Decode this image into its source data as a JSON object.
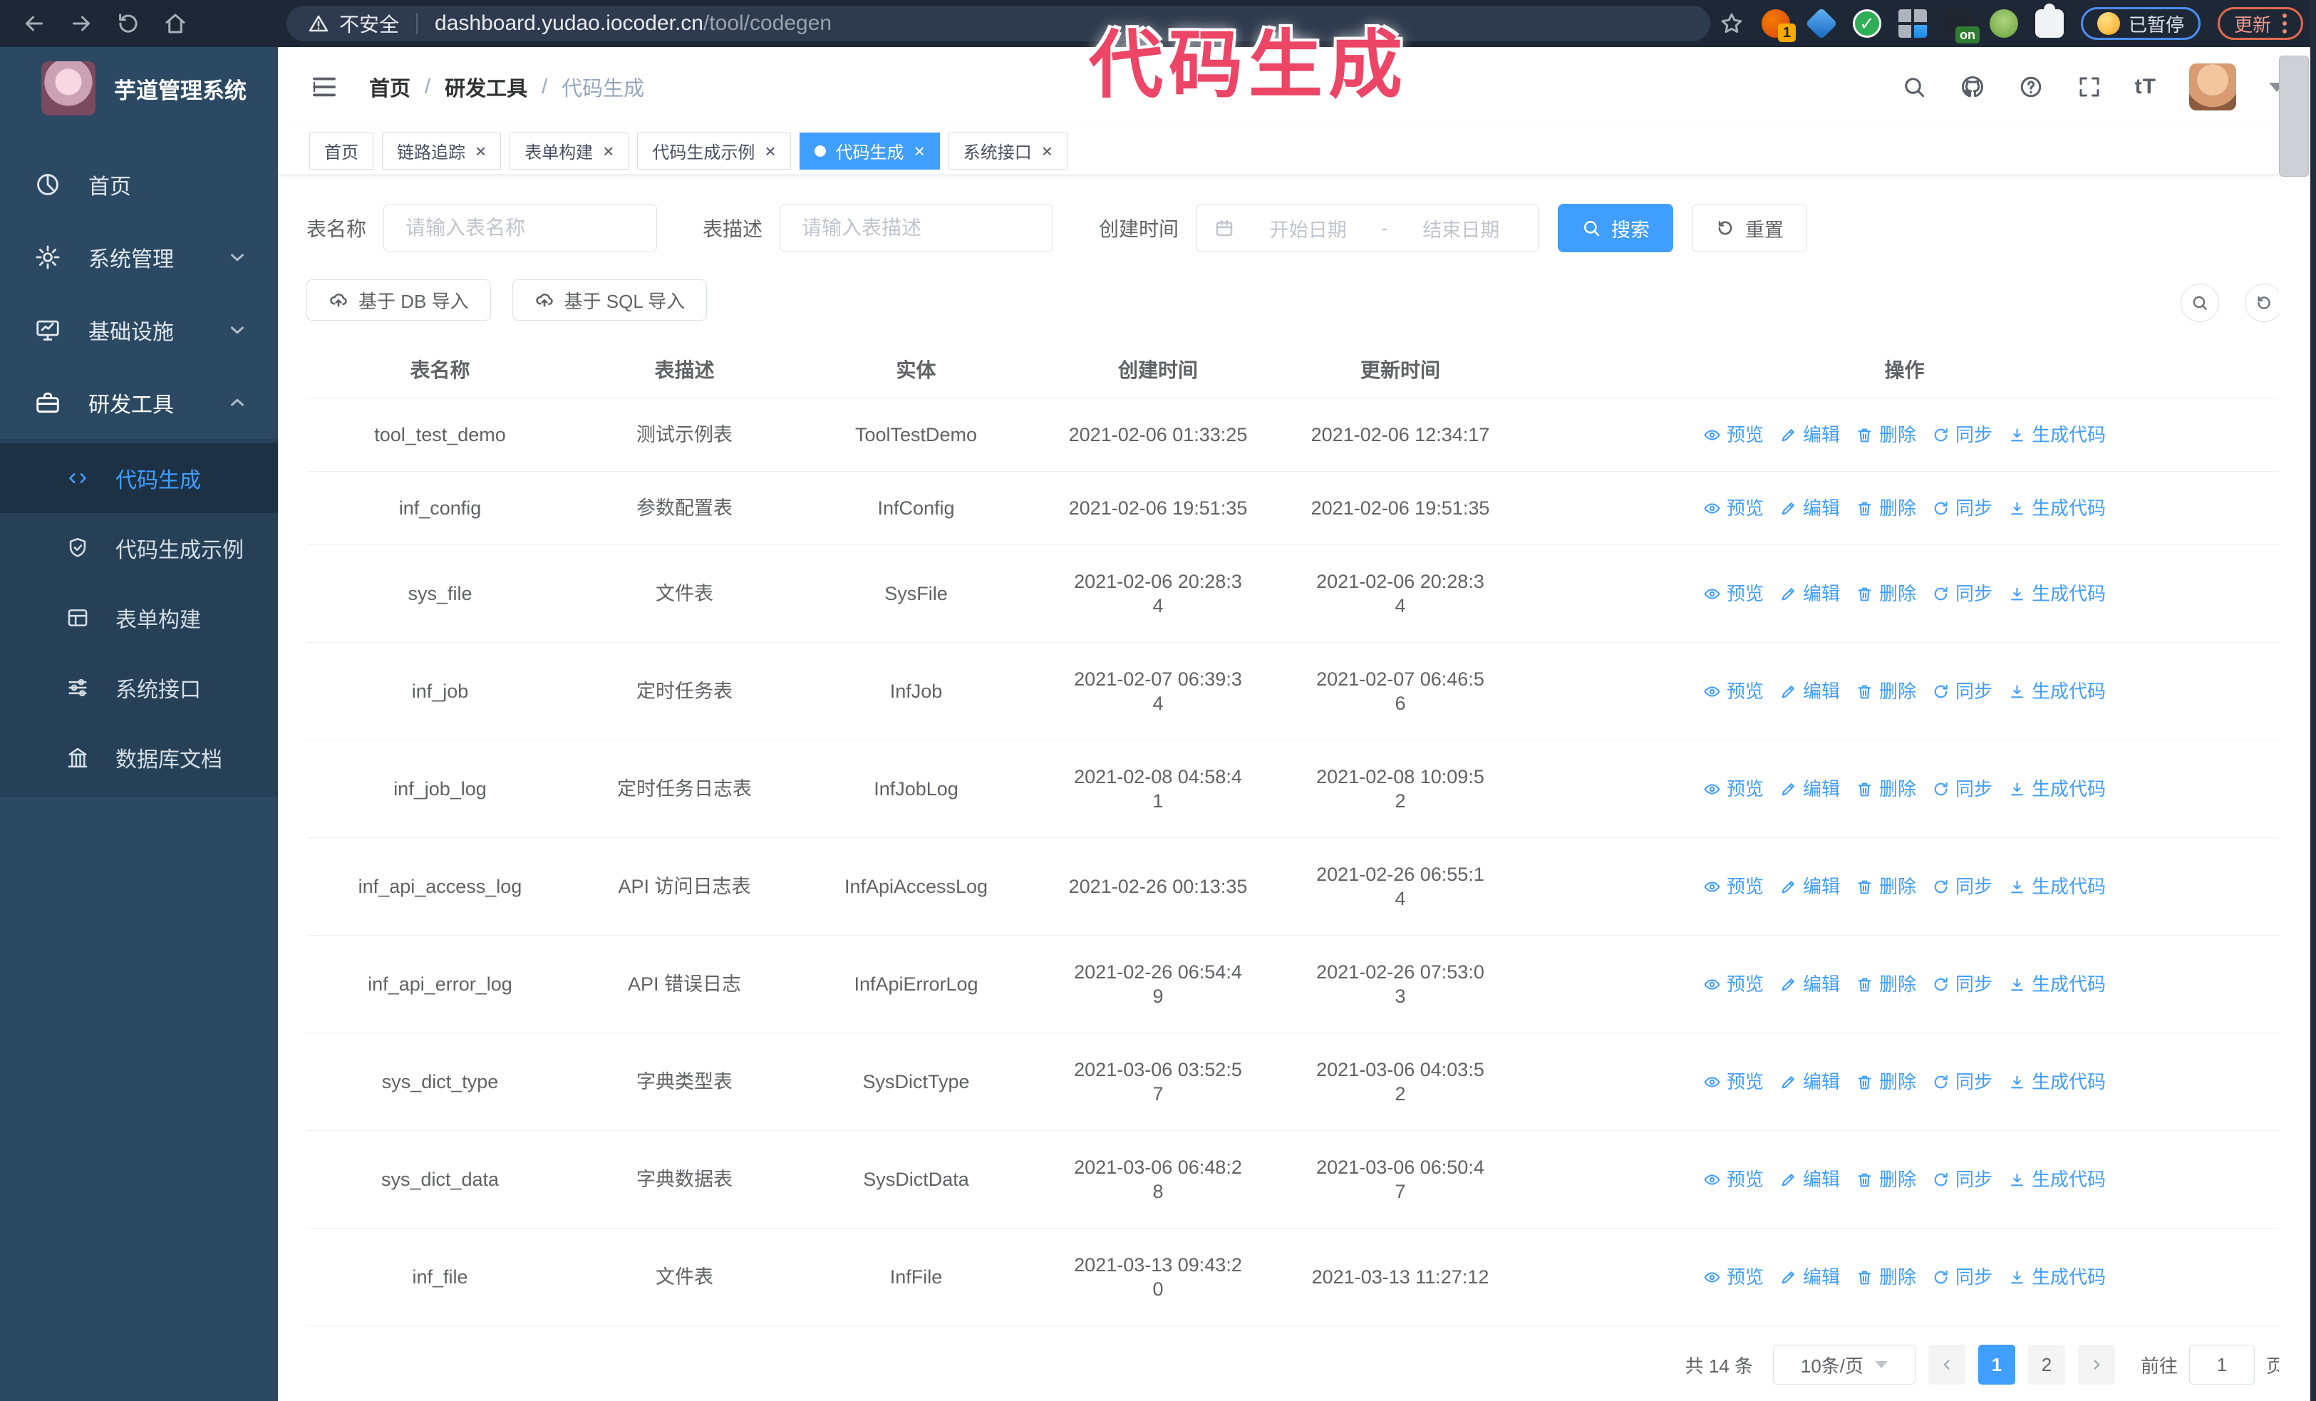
{
  "browser": {
    "security_label": "不安全",
    "url_host": "dashboard.yudao.iocoder.cn",
    "url_path": "/tool/codegen",
    "extension_badge": "1",
    "on_badge": "on",
    "paused_label": "已暂停",
    "update_label": "更新"
  },
  "annotation": {
    "text": "代码生成"
  },
  "sidebar": {
    "title": "芋道管理系统",
    "items": [
      {
        "label": "首页",
        "icon": "home",
        "chevron": "",
        "active": false
      },
      {
        "label": "系统管理",
        "icon": "gear",
        "chevron": "down",
        "active": false
      },
      {
        "label": "基础设施",
        "icon": "monitor",
        "chevron": "down",
        "active": false
      },
      {
        "label": "研发工具",
        "icon": "toolbox",
        "chevron": "up",
        "active": true
      }
    ],
    "subitems": [
      {
        "label": "代码生成",
        "icon": "code",
        "active": true
      },
      {
        "label": "代码生成示例",
        "icon": "shield",
        "active": false
      },
      {
        "label": "表单构建",
        "icon": "form",
        "active": false
      },
      {
        "label": "系统接口",
        "icon": "sliders",
        "active": false
      },
      {
        "label": "数据库文档",
        "icon": "db",
        "active": false
      }
    ]
  },
  "header": {
    "breadcrumb": [
      "首页",
      "研发工具",
      "代码生成"
    ],
    "separator": "/",
    "font_icon_label": "tT"
  },
  "tabs": [
    {
      "label": "首页",
      "closable": false,
      "active": false
    },
    {
      "label": "链路追踪",
      "closable": true,
      "active": false
    },
    {
      "label": "表单构建",
      "closable": true,
      "active": false
    },
    {
      "label": "代码生成示例",
      "closable": true,
      "active": false
    },
    {
      "label": "代码生成",
      "closable": true,
      "active": true
    },
    {
      "label": "系统接口",
      "closable": true,
      "active": false
    }
  ],
  "filters": {
    "table_name_label": "表名称",
    "table_name_placeholder": "请输入表名称",
    "table_desc_label": "表描述",
    "table_desc_placeholder": "请输入表描述",
    "create_time_label": "创建时间",
    "date_start_placeholder": "开始日期",
    "date_separator": "-",
    "date_end_placeholder": "结束日期",
    "search_label": "搜索",
    "reset_label": "重置"
  },
  "toolbar": {
    "import_db": "基于 DB 导入",
    "import_sql": "基于 SQL 导入"
  },
  "table": {
    "columns": [
      "表名称",
      "表描述",
      "实体",
      "创建时间",
      "更新时间",
      "操作"
    ],
    "actions": [
      "预览",
      "编辑",
      "删除",
      "同步",
      "生成代码"
    ],
    "rows": [
      {
        "name": "tool_test_demo",
        "desc": "测试示例表",
        "entity": "ToolTestDemo",
        "created": "2021-02-06 01:33:25",
        "updated": "2021-02-06 12:34:17"
      },
      {
        "name": "inf_config",
        "desc": "参数配置表",
        "entity": "InfConfig",
        "created": "2021-02-06 19:51:35",
        "updated": "2021-02-06 19:51:35"
      },
      {
        "name": "sys_file",
        "desc": "文件表",
        "entity": "SysFile",
        "created": "2021-02-06 20:28:3\n4",
        "updated": "2021-02-06 20:28:3\n4"
      },
      {
        "name": "inf_job",
        "desc": "定时任务表",
        "entity": "InfJob",
        "created": "2021-02-07 06:39:3\n4",
        "updated": "2021-02-07 06:46:5\n6"
      },
      {
        "name": "inf_job_log",
        "desc": "定时任务日志表",
        "entity": "InfJobLog",
        "created": "2021-02-08 04:58:4\n1",
        "updated": "2021-02-08 10:09:5\n2"
      },
      {
        "name": "inf_api_access_log",
        "desc": "API 访问日志表",
        "entity": "InfApiAccessLog",
        "created": "2021-02-26 00:13:35",
        "updated": "2021-02-26 06:55:1\n4"
      },
      {
        "name": "inf_api_error_log",
        "desc": "API 错误日志",
        "entity": "InfApiErrorLog",
        "created": "2021-02-26 06:54:4\n9",
        "updated": "2021-02-26 07:53:0\n3"
      },
      {
        "name": "sys_dict_type",
        "desc": "字典类型表",
        "entity": "SysDictType",
        "created": "2021-03-06 03:52:5\n7",
        "updated": "2021-03-06 04:03:5\n2"
      },
      {
        "name": "sys_dict_data",
        "desc": "字典数据表",
        "entity": "SysDictData",
        "created": "2021-03-06 06:48:2\n8",
        "updated": "2021-03-06 06:50:4\n7"
      },
      {
        "name": "inf_file",
        "desc": "文件表",
        "entity": "InfFile",
        "created": "2021-03-13 09:43:2\n0",
        "updated": "2021-03-13 11:27:12"
      }
    ]
  },
  "pagination": {
    "total": "共 14 条",
    "page_size": "10条/页",
    "pages": [
      "1",
      "2"
    ],
    "active_page": "1",
    "goto_label": "前往",
    "goto_value": "1",
    "page_unit": "页"
  },
  "colors": {
    "accent": "#409eff",
    "sidebar_bg": "#2b4963",
    "topbar_bg": "#1e2736",
    "annotation_red": "#ec4566"
  }
}
